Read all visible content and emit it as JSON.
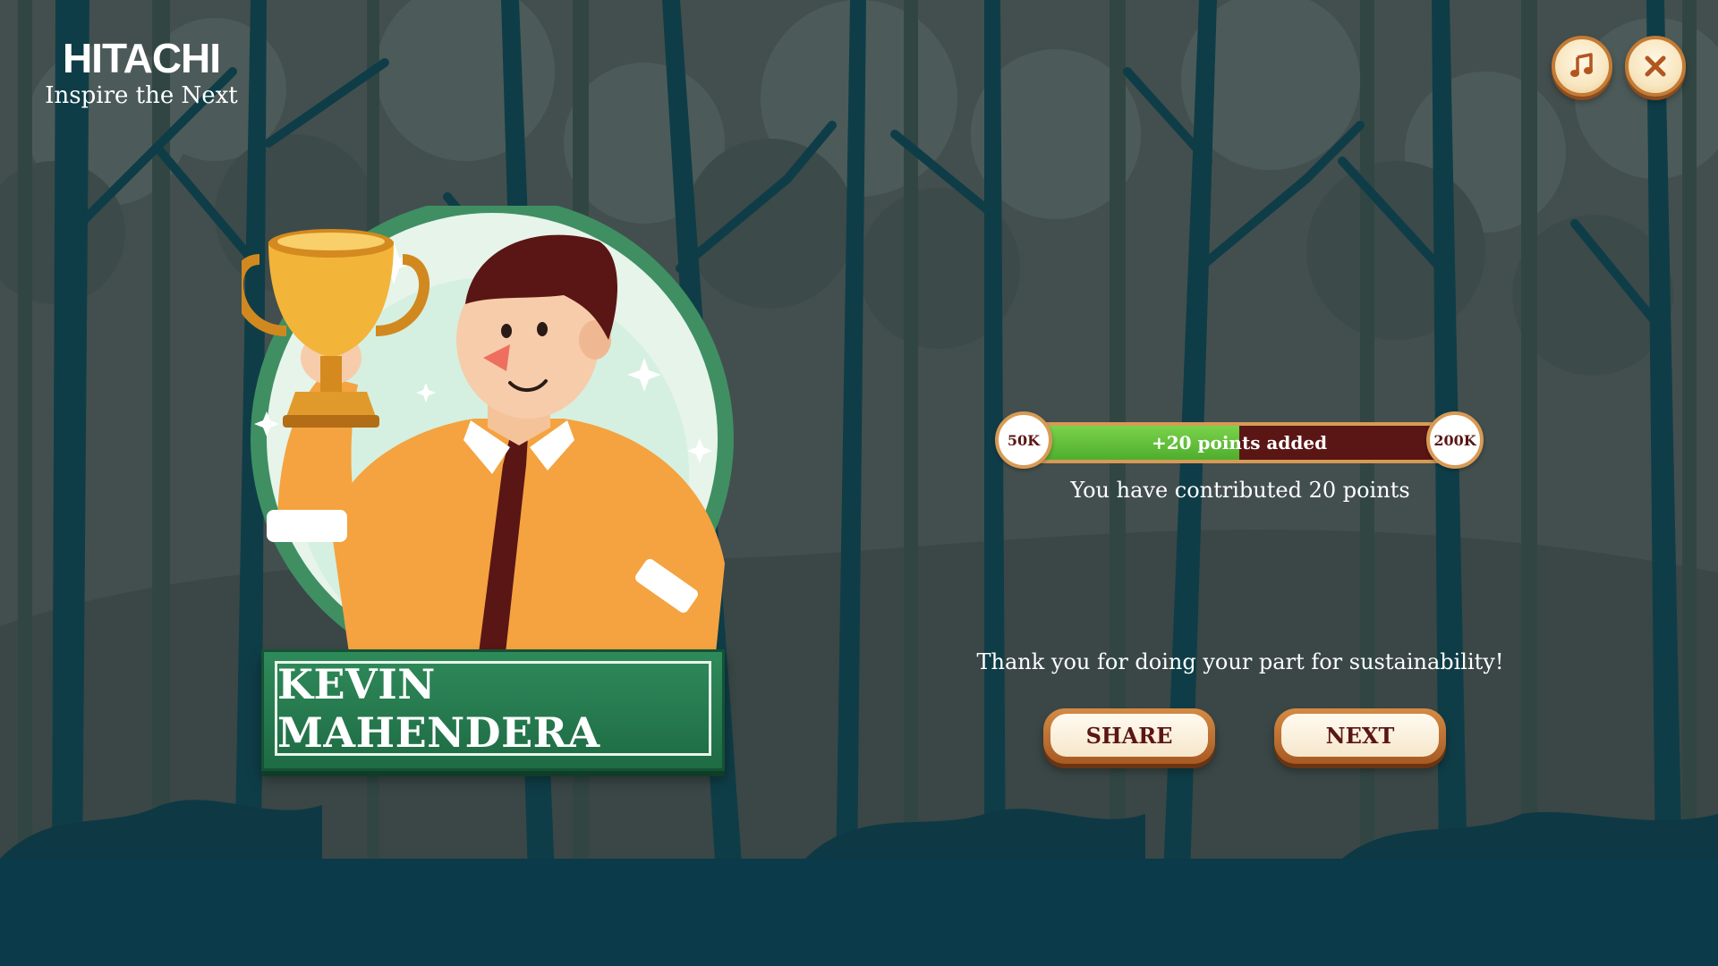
{
  "brand": {
    "name": "HITACHI",
    "tagline": "Inspire the Next"
  },
  "controls": {
    "music_icon": "music-note-icon",
    "close_icon": "close-x-icon"
  },
  "player": {
    "name": "KEVIN MAHENDERA"
  },
  "progress": {
    "start_label": "50K",
    "end_label": "200K",
    "bar_label": "+20 points added",
    "fill_fraction": 0.5
  },
  "messages": {
    "contribution": "You have contributed 20 points",
    "thanks": "Thank you for doing your part for sustainability!"
  },
  "buttons": {
    "share_label": "SHARE",
    "next_label": "NEXT"
  },
  "colors": {
    "forest_bg": "#3f4b4a",
    "ground": "#0b3a4a",
    "plaque_green": "#1e6b44",
    "bar_green": "#4fae2e",
    "bar_maroon": "#5a1614",
    "wood": "#c47b35"
  }
}
